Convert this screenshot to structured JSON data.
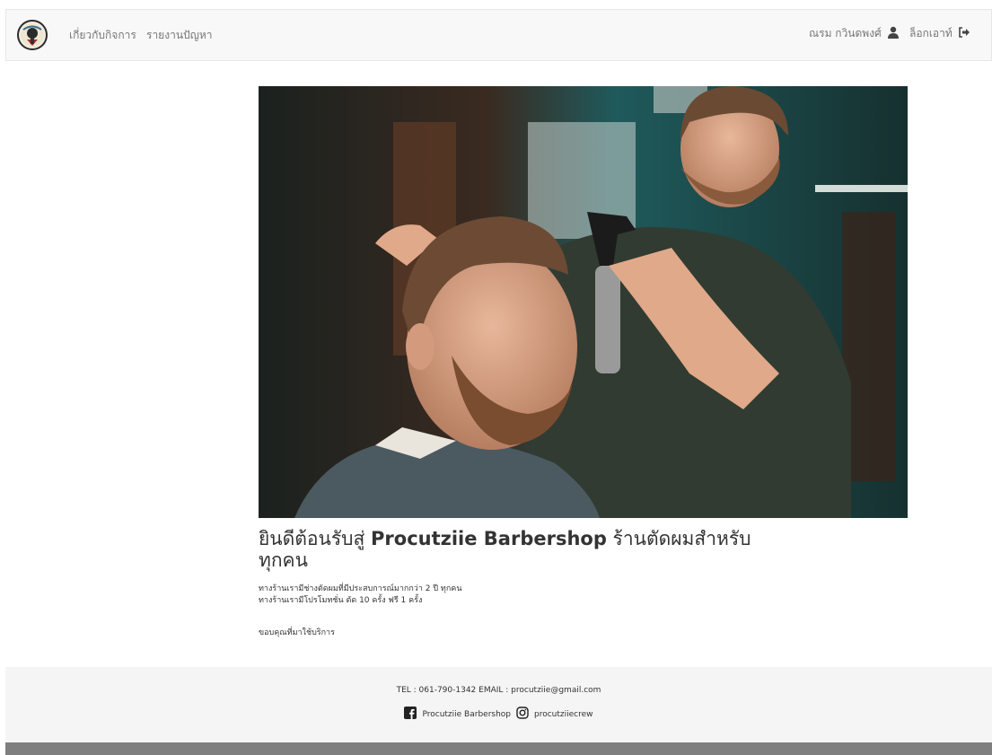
{
  "navbar": {
    "logo_icon": "barbershop-logo-icon",
    "links": [
      {
        "label": "เกี่ยวกับกิจการ"
      },
      {
        "label": "รายงานปัญหา"
      }
    ],
    "user_name": "ณรม กวินดพงศ์",
    "user_icon": "user-icon",
    "logout_label": "ล็อกเอาท์",
    "logout_icon": "logout-icon"
  },
  "hero": {
    "image_icon": "barber-photo"
  },
  "main": {
    "title_prefix": "ยินดีต้อนรับสู่ ",
    "title_brand": "Procutziie Barbershop",
    "title_suffix": " ร้านตัดผมสำหรับทุกคน",
    "line1": "ทางร้านเรามีช่างตัดผมที่มีประสบการณ์มากกว่า 2 ปี ทุกคน",
    "line2": "ทางร้านเรามีโปรโมทชั่น ตัด 10 ครั้ง ฟรี 1 ครั้ง",
    "thanks": "ขอบคุณที่มาใช้บริการ"
  },
  "footer": {
    "contact": "TEL : 061-790-1342 EMAIL : procutziie@gmail.com",
    "facebook_icon": "facebook-icon",
    "facebook_label": "Procutziie Barbershop",
    "instagram_icon": "instagram-icon",
    "instagram_label": "procutziiecrew"
  }
}
